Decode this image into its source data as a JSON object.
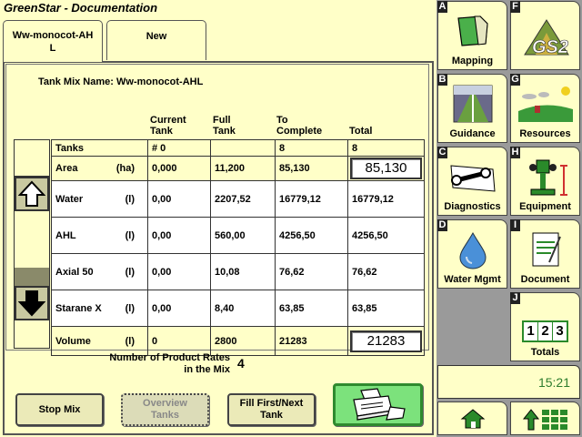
{
  "title": "GreenStar - Documentation",
  "tabs": [
    {
      "label": "Ww-monocot-AH\nL"
    },
    {
      "label": "New"
    }
  ],
  "tank_mix": {
    "label": "Tank Mix Name:",
    "name": "Ww-monocot-AHL"
  },
  "columns": {
    "current": "Current\nTank",
    "full": "Full\nTank",
    "to_complete": "To\nComplete",
    "total": "Total"
  },
  "rows": {
    "tanks": {
      "name": "Tanks",
      "unit": "",
      "current": "# 0",
      "full": "",
      "to_complete": "8",
      "total": "8"
    },
    "area": {
      "name": "Area",
      "unit": "(ha)",
      "current": "0,000",
      "full": "11,200",
      "to_complete": "85,130",
      "total": "85,130"
    },
    "products": [
      {
        "name": "Water",
        "unit": "(l)",
        "current": "0,00",
        "full": "2207,52",
        "to_complete": "16779,12",
        "total": "16779,12"
      },
      {
        "name": "AHL",
        "unit": "(l)",
        "current": "0,00",
        "full": "560,00",
        "to_complete": "4256,50",
        "total": "4256,50"
      },
      {
        "name": "Axial 50",
        "unit": "(l)",
        "current": "0,00",
        "full": "10,08",
        "to_complete": "76,62",
        "total": "76,62"
      },
      {
        "name": "Starane X",
        "unit": "(l)",
        "current": "0,00",
        "full": "8,40",
        "to_complete": "63,85",
        "total": "63,85"
      }
    ],
    "volume": {
      "name": "Volume",
      "unit": "(l)",
      "current": "0",
      "full": "2800",
      "to_complete": "21283",
      "total": "21283"
    }
  },
  "product_rates": {
    "label": "Number of Product Rates\nin the Mix",
    "value": "4"
  },
  "buttons": {
    "stop_mix": "Stop Mix",
    "overview_tanks": "Overview\nTanks",
    "fill_first": "Fill First/Next\nTank"
  },
  "sidebar": {
    "items": [
      {
        "letter": "A",
        "label": "Mapping",
        "icon": "map-icon"
      },
      {
        "letter": "F",
        "label": "",
        "icon": "gs2-logo",
        "logo_text": "GS2"
      },
      {
        "letter": "B",
        "label": "Guidance",
        "icon": "guidance-icon"
      },
      {
        "letter": "G",
        "label": "Resources",
        "icon": "resources-icon"
      },
      {
        "letter": "C",
        "label": "Diagnostics",
        "icon": "wrench-icon"
      },
      {
        "letter": "H",
        "label": "Equipment",
        "icon": "tractor-icon"
      },
      {
        "letter": "D",
        "label": "Water Mgmt",
        "icon": "water-drop-icon"
      },
      {
        "letter": "I",
        "label": "Document",
        "icon": "document-icon"
      },
      {
        "letter": "J",
        "label": "Totals",
        "icon": "totals-icon",
        "digits": [
          "1",
          "2",
          "3"
        ]
      }
    ],
    "time": "15:21"
  },
  "colors": {
    "panel_bg": "#ffffc8",
    "accent_green": "#7ce27c",
    "time_green": "#2e7d2e"
  }
}
